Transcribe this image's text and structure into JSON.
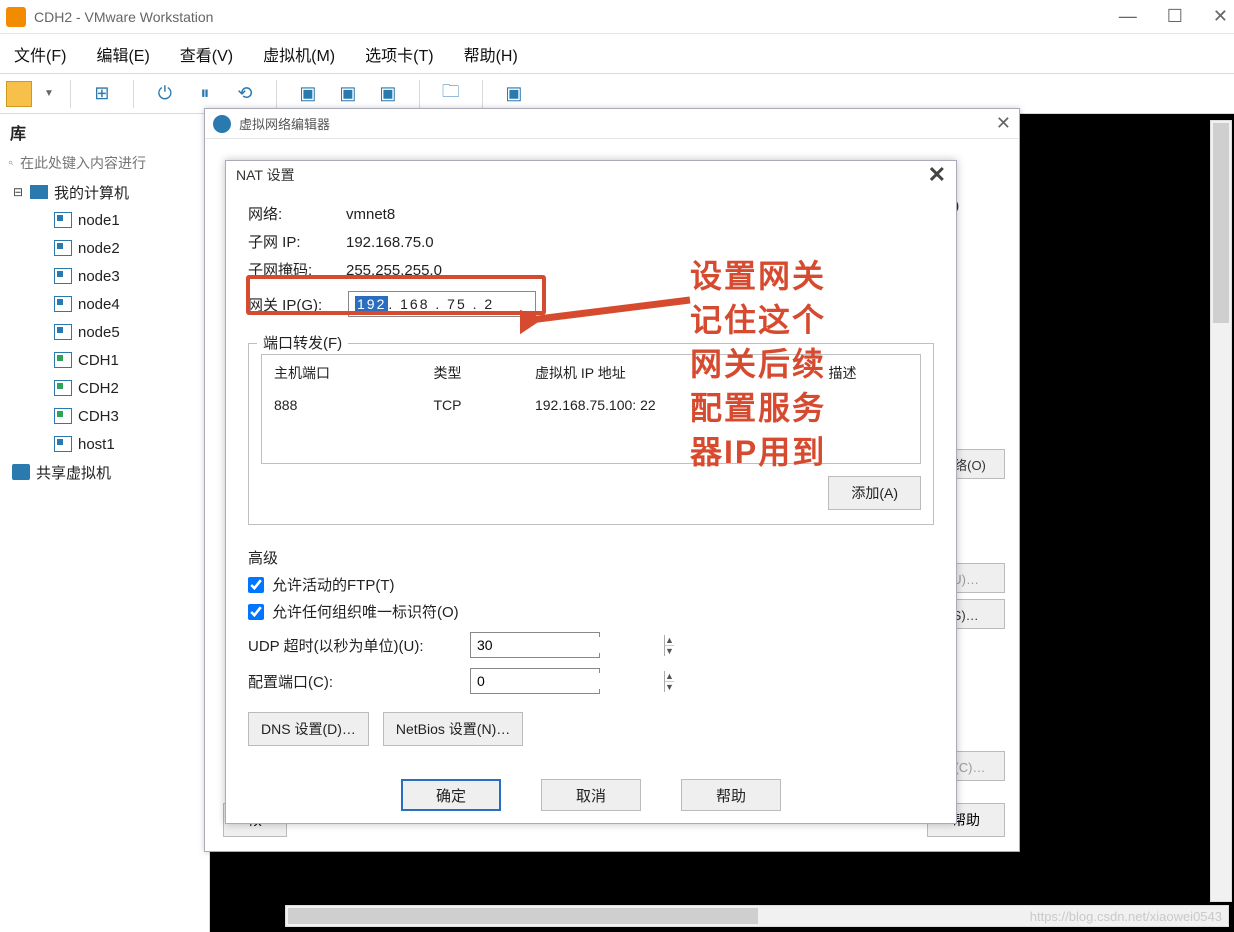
{
  "window": {
    "title": "CDH2 - VMware Workstation"
  },
  "menu": {
    "file": "文件(F)",
    "edit": "编辑(E)",
    "view": "查看(V)",
    "vm": "虚拟机(M)",
    "tabs": "选项卡(T)",
    "help": "帮助(H)"
  },
  "sidebar": {
    "library": "库",
    "search_placeholder": "在此处键入内容进行",
    "root": "我的计算机",
    "items": [
      {
        "label": "node1",
        "running": false
      },
      {
        "label": "node2",
        "running": false
      },
      {
        "label": "node3",
        "running": false
      },
      {
        "label": "node4",
        "running": false
      },
      {
        "label": "node5",
        "running": false
      },
      {
        "label": "CDH1",
        "running": true
      },
      {
        "label": "CDH2",
        "running": true
      },
      {
        "label": "CDH3",
        "running": true
      },
      {
        "label": "host1",
        "running": false
      }
    ],
    "shared": "共享虚拟机"
  },
  "dlg1": {
    "title": "虚拟网络编辑器",
    "zero": "0",
    "remove_network": "除网络(O)",
    "setting_u": "置(U)…",
    "setting_s": "置(S)…",
    "setting_c": "设置(C)…",
    "help": "帮助",
    "ok_hint": "恢"
  },
  "nat": {
    "title": "NAT 设置",
    "network_label": "网络:",
    "network_value": "vmnet8",
    "subnet_ip_label": "子网 IP:",
    "subnet_ip_value": "192.168.75.0",
    "subnet_mask_label": "子网掩码:",
    "subnet_mask_value": "255.255.255.0",
    "gateway_label": "网关 IP(G):",
    "gateway_sel": "192",
    "gateway_rest": ". 168 . 75 . 2",
    "portfwd_title": "端口转发(F)",
    "cols": {
      "host_port": "主机端口",
      "type": "类型",
      "vm_addr": "虚拟机 IP 地址",
      "desc": "描述"
    },
    "rows": [
      {
        "host_port": "888",
        "type": "TCP",
        "vm_addr": "192.168.75.100: 22",
        "desc": ""
      }
    ],
    "add": "添加(A)",
    "advanced": "高级",
    "allow_ftp": "允许活动的FTP(T)",
    "allow_oui": "允许任何组织唯一标识符(O)",
    "udp_timeout_label": "UDP 超时(以秒为单位)(U):",
    "udp_timeout_value": "30",
    "config_port_label": "配置端口(C):",
    "config_port_value": "0",
    "dns_btn": "DNS 设置(D)…",
    "netbios_btn": "NetBios 设置(N)…",
    "ok": "确定",
    "cancel": "取消",
    "help": "帮助"
  },
  "annotation": {
    "line1": "设置网关",
    "line2": "记住这个",
    "line3": "网关后续",
    "line4": "配置服务",
    "line5": "器IP用到",
    "arrow_glyph": "➤"
  },
  "watermark": "https://blog.csdn.net/xiaowei0543"
}
